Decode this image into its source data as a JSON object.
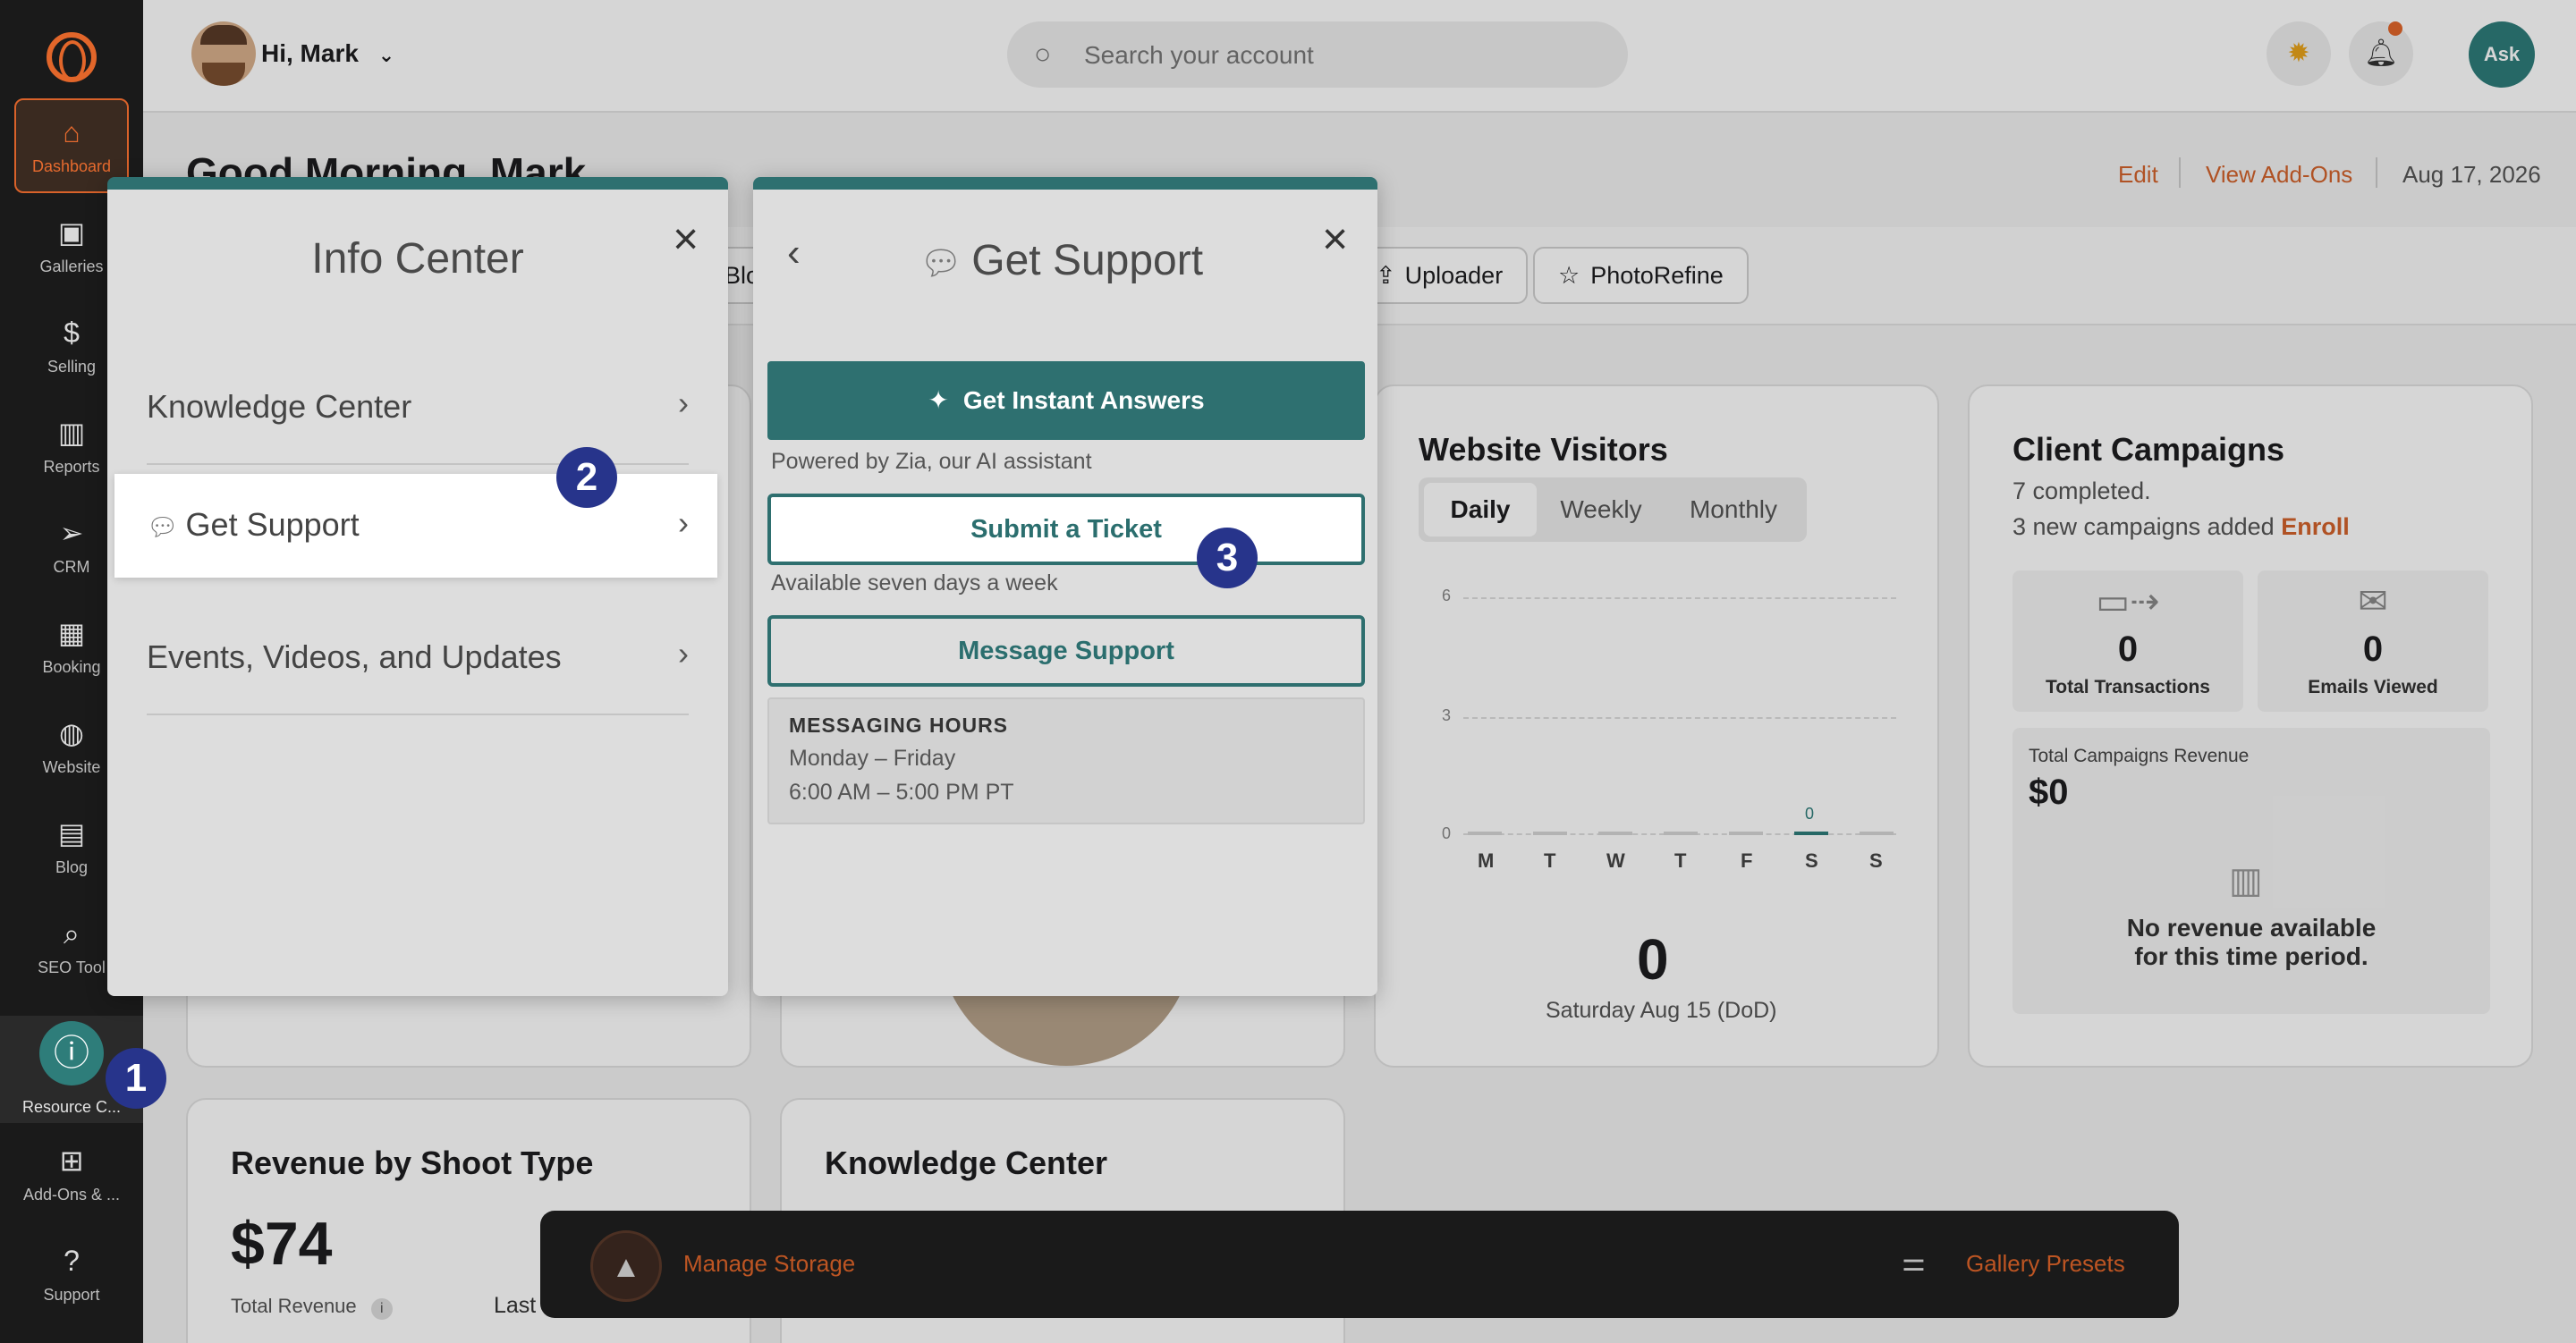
{
  "sidebar": {
    "items": [
      {
        "label": "Dashboard",
        "icon": "home-icon"
      },
      {
        "label": "Galleries",
        "icon": "image-icon"
      },
      {
        "label": "Selling",
        "icon": "dollar-icon"
      },
      {
        "label": "Reports",
        "icon": "bar-chart-icon"
      },
      {
        "label": "CRM",
        "icon": "send-icon"
      },
      {
        "label": "Booking",
        "icon": "calendar-icon"
      },
      {
        "label": "Website",
        "icon": "globe-icon"
      },
      {
        "label": "Blog",
        "icon": "document-icon"
      },
      {
        "label": "SEO Tool",
        "icon": "seo-icon"
      }
    ],
    "resource_label": "Resource C...",
    "addons_label": "Add-Ons & ...",
    "support_label": "Support"
  },
  "topbar": {
    "greeting": "Hi, Mark",
    "search_placeholder": "Search your account",
    "ask_label": "Ask"
  },
  "header": {
    "title": "Good Morning, Mark",
    "edit": "Edit",
    "view_addons": "View Add-Ons",
    "date": "Aug 17, 2026"
  },
  "quick_actions": {
    "partial": "Blo",
    "uploader": "Uploader",
    "photorefine": "PhotoRefine"
  },
  "website_visitors": {
    "title": "Website Visitors",
    "tabs": [
      "Daily",
      "Weekly",
      "Monthly"
    ],
    "y_ticks": [
      "6",
      "3",
      "0"
    ],
    "days": [
      "M",
      "T",
      "W",
      "T",
      "F",
      "S",
      "S"
    ],
    "highlight_value": "0",
    "total": "0",
    "caption": "Saturday Aug 15 (DoD)"
  },
  "client_campaigns": {
    "title": "Client Campaigns",
    "completed": "7 completed.",
    "new_added": "3 new campaigns added",
    "enroll": "Enroll",
    "total_transactions_value": "0",
    "total_transactions_label": "Total Transactions",
    "emails_viewed_value": "0",
    "emails_viewed_label": "Emails Viewed",
    "revenue_label": "Total Campaigns Revenue",
    "revenue_value": "$0",
    "no_revenue_line1": "No revenue available",
    "no_revenue_line2": "for this time period."
  },
  "revenue_by_shoot": {
    "title": "Revenue by Shoot Type",
    "value": "$74",
    "label": "Total Revenue",
    "last": "Last"
  },
  "knowledge_card": {
    "title": "Knowledge Center"
  },
  "bottombar": {
    "manage_storage": "Manage Storage",
    "gallery_presets": "Gallery Presets"
  },
  "info_center": {
    "title": "Info Center",
    "items": [
      "Knowledge Center",
      "Get Support",
      "Events, Videos, and Updates"
    ]
  },
  "get_support": {
    "title": "Get Support",
    "instant_answers": "Get Instant Answers",
    "powered_by": "Powered by Zia, our AI assistant",
    "submit_ticket": "Submit a Ticket",
    "available": "Available seven days a week",
    "message_support": "Message Support",
    "hours_title": "MESSAGING HOURS",
    "hours_days": "Monday – Friday",
    "hours_time": "6:00 AM – 5:00 PM PT"
  },
  "step_badges": [
    "1",
    "2",
    "3"
  ]
}
